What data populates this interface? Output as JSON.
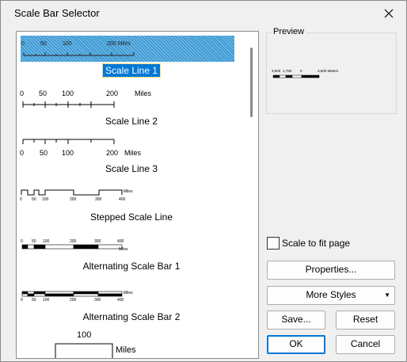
{
  "dialog": {
    "title": "Scale Bar Selector"
  },
  "list": {
    "items": [
      {
        "label": "Scale Line 1",
        "ticks": [
          "0",
          "50",
          "100",
          "200 Miles"
        ],
        "selected": true
      },
      {
        "label": "Scale Line 2",
        "ticks": [
          "0",
          "50",
          "100",
          "200"
        ],
        "units": "Miles"
      },
      {
        "label": "Scale Line 3",
        "ticks": [
          "0",
          "50",
          "100",
          "200"
        ],
        "units": "Miles"
      },
      {
        "label": "Stepped Scale Line",
        "ticks": [
          "0",
          "50",
          "100",
          "200",
          "300",
          "400"
        ],
        "units": "Miles"
      },
      {
        "label": "Alternating Scale Bar 1",
        "ticks": [
          "0",
          "50",
          "100",
          "200",
          "300",
          "400"
        ],
        "units": "Miles"
      },
      {
        "label": "Alternating Scale Bar 2",
        "ticks": [
          "0",
          "50",
          "100",
          "200",
          "300",
          "400"
        ],
        "units": "Miles"
      },
      {
        "tick": "100",
        "units": "Miles"
      }
    ]
  },
  "preview": {
    "label": "Preview",
    "ticks": [
      "3,500",
      "1,750",
      "0",
      "3,500 Meters"
    ]
  },
  "scale_to_fit": {
    "label": "Scale to fit page",
    "checked": false
  },
  "buttons": {
    "properties": "Properties...",
    "more_styles": "More Styles",
    "save": "Save...",
    "reset": "Reset",
    "ok": "OK",
    "cancel": "Cancel"
  },
  "colors": {
    "selection": "#0078d7",
    "hatch": "#3e9bd6"
  }
}
